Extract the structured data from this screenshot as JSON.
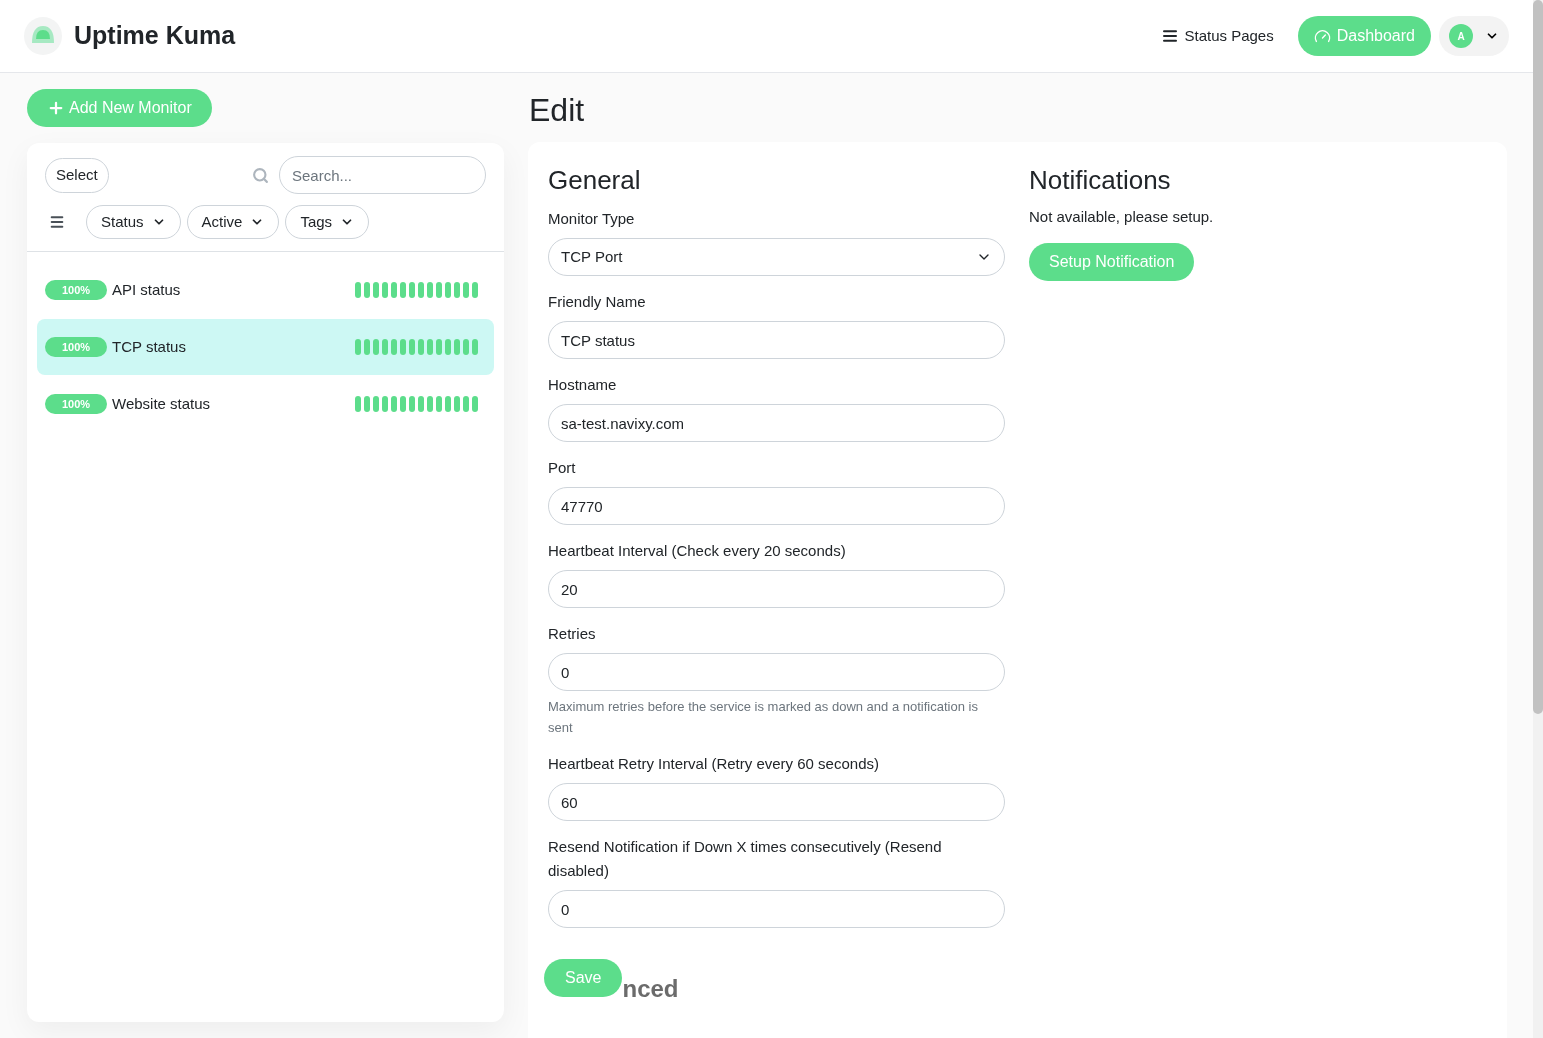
{
  "header": {
    "brand": "Uptime Kuma",
    "status_pages": "Status Pages",
    "dashboard": "Dashboard",
    "avatar": "A"
  },
  "sidebar": {
    "add_button": "Add New Monitor",
    "select_button": "Select",
    "search": {
      "placeholder": "Search..."
    },
    "filters": [
      "Status",
      "Active",
      "Tags"
    ],
    "monitors": [
      {
        "uptime": "100%",
        "name": "API status",
        "selected": false
      },
      {
        "uptime": "100%",
        "name": "TCP status",
        "selected": true
      },
      {
        "uptime": "100%",
        "name": "Website status",
        "selected": false
      }
    ]
  },
  "page_title": "Edit",
  "general": {
    "title": "General",
    "fields": [
      {
        "kind": "select",
        "label": "Monitor Type",
        "value": "TCP Port"
      },
      {
        "kind": "input",
        "label": "Friendly Name",
        "value": "TCP status"
      },
      {
        "kind": "input",
        "label": "Hostname",
        "value": "sa-test.navixy.com"
      },
      {
        "kind": "input",
        "label": "Port",
        "value": "47770"
      },
      {
        "kind": "input",
        "label": "Heartbeat Interval (Check every 20 seconds)",
        "value": "20"
      },
      {
        "kind": "input",
        "label": "Retries",
        "value": "0",
        "help": "Maximum retries before the service is marked as down and a notification is sent"
      },
      {
        "kind": "input",
        "label": "Heartbeat Retry Interval (Retry every 60 seconds)",
        "value": "60"
      },
      {
        "kind": "input",
        "label": "Resend Notification if Down X times consecutively (Resend disabled)",
        "value": "0"
      }
    ],
    "save": "Save",
    "advanced": "nced"
  },
  "notifications": {
    "title": "Notifications",
    "text": "Not available, please setup.",
    "button": "Setup Notification"
  }
}
